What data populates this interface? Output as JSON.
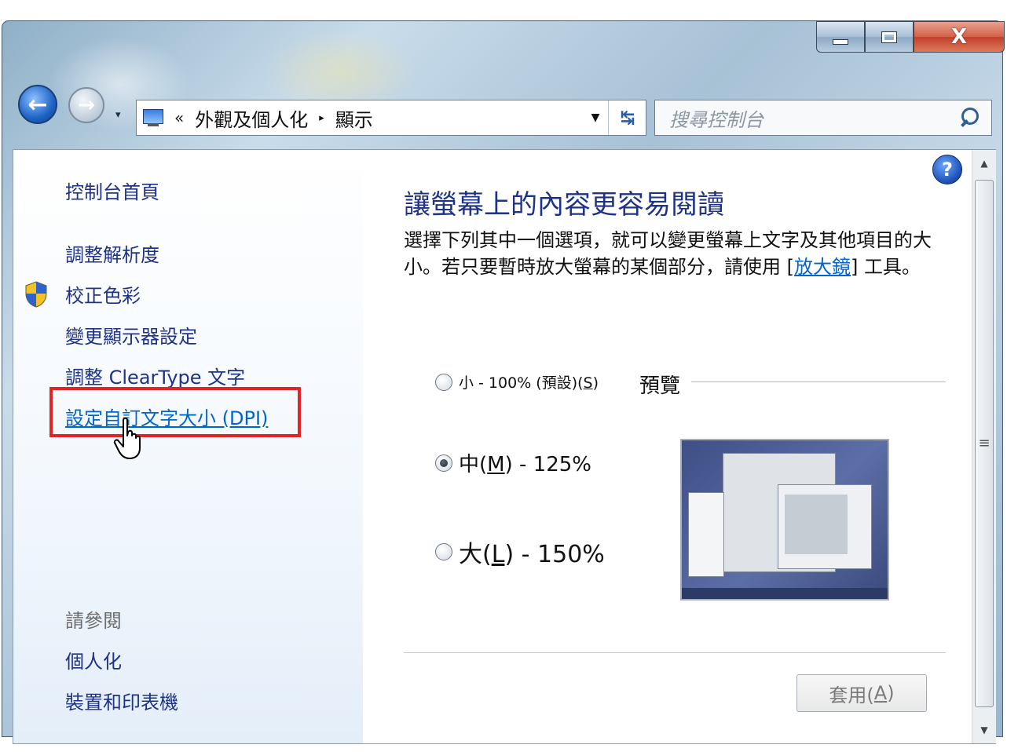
{
  "window": {
    "controls": {
      "minimize": "minimize",
      "maximize": "maximize",
      "close": "X"
    }
  },
  "nav": {
    "address": {
      "chevron": "«",
      "segment1": "外觀及個人化",
      "separator": "▸",
      "segment2": "顯示"
    },
    "search": {
      "placeholder": "搜尋控制台"
    }
  },
  "sidebar": {
    "items": [
      {
        "label": "控制台首頁"
      },
      {
        "label": "調整解析度"
      },
      {
        "label": "校正色彩"
      },
      {
        "label": "變更顯示器設定"
      },
      {
        "label": "調整 ClearType 文字"
      },
      {
        "label": "設定自訂文字大小 (DPI)"
      }
    ],
    "see_also_title": "請參閱",
    "see_also": [
      {
        "label": "個人化"
      },
      {
        "label": "裝置和印表機"
      }
    ]
  },
  "main": {
    "heading": "讓螢幕上的內容更容易閱讀",
    "desc_text": "選擇下列其中一個選項，就可以變更螢幕上文字及其他項目的大小。若只要暫時放大螢幕的某個部分，請使用 [",
    "desc_link": "放大鏡",
    "desc_tail": "] 工具。",
    "options": [
      {
        "prefix": "小 - 100% (預設)(",
        "key": "S",
        "suffix": ")",
        "selected": false
      },
      {
        "prefix": "中(",
        "key": "M",
        "suffix": ") - 125%",
        "selected": true
      },
      {
        "prefix": "大(",
        "key": "L",
        "suffix": ") - 150%",
        "selected": false
      }
    ],
    "preview_label": "預覽",
    "apply": {
      "prefix": "套用(",
      "key": "A",
      "suffix": ")"
    }
  },
  "colors": {
    "link": "#0066cc",
    "nav_text": "#1e3287",
    "highlight_box": "#e52323"
  }
}
